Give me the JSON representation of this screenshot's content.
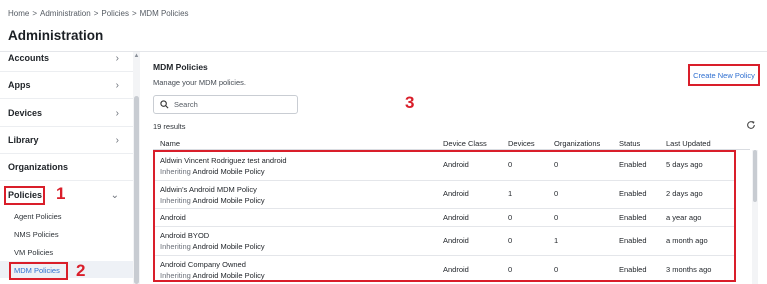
{
  "breadcrumb": [
    "Home",
    ">",
    "Administration",
    ">",
    "Policies",
    ">",
    "MDM Policies"
  ],
  "page_title": "Administration",
  "sidebar": {
    "items": [
      {
        "label": "Accounts",
        "icon": "chevron-right-icon",
        "glyph": "›"
      },
      {
        "label": "Apps",
        "icon": "chevron-right-icon",
        "glyph": "›"
      },
      {
        "label": "Devices",
        "icon": "chevron-right-icon",
        "glyph": "›"
      },
      {
        "label": "Library",
        "icon": "chevron-right-icon",
        "glyph": "›"
      },
      {
        "label": "Organizations",
        "icon": "",
        "glyph": ""
      },
      {
        "label": "Policies",
        "icon": "chevron-down-icon",
        "glyph": "⌄"
      }
    ],
    "sub_items": [
      "Agent Policies",
      "NMS Policies",
      "VM Policies",
      "MDM Policies"
    ],
    "active_sub": "MDM Policies"
  },
  "annotations": [
    "1",
    "2",
    "3"
  ],
  "main": {
    "title": "MDM Policies",
    "subtitle": "Manage your MDM policies.",
    "create_button": "Create New Policy",
    "search_placeholder": "Search",
    "results_count": "19 results",
    "columns": [
      "Name",
      "Device Class",
      "Devices",
      "Organizations",
      "Status",
      "Last Updated"
    ],
    "rows": [
      {
        "name": "Aldwin Vincent Rodriguez test android",
        "inherit_prefix": "Inheriting",
        "inherit": "Android Mobile Policy",
        "class": "Android",
        "devices": "0",
        "orgs": "0",
        "status": "Enabled",
        "updated": "5 days ago"
      },
      {
        "name": "Aldwin's Android MDM Policy",
        "inherit_prefix": "Inheriting",
        "inherit": "Android Mobile Policy",
        "class": "Android",
        "devices": "1",
        "orgs": "0",
        "status": "Enabled",
        "updated": "2 days ago"
      },
      {
        "name": "Android",
        "inherit_prefix": "",
        "inherit": "",
        "class": "Android",
        "devices": "0",
        "orgs": "0",
        "status": "Enabled",
        "updated": "a year ago"
      },
      {
        "name": "Android BYOD",
        "inherit_prefix": "Inheriting",
        "inherit": "Android Mobile Policy",
        "class": "Android",
        "devices": "0",
        "orgs": "1",
        "status": "Enabled",
        "updated": "a month ago"
      },
      {
        "name": "Android Company Owned",
        "inherit_prefix": "Inheriting",
        "inherit": "Android Mobile Policy",
        "class": "Android",
        "devices": "0",
        "orgs": "0",
        "status": "Enabled",
        "updated": "3 months ago"
      }
    ]
  },
  "colors": {
    "accent": "#2f6fd0",
    "highlight": "#d91e2a"
  }
}
